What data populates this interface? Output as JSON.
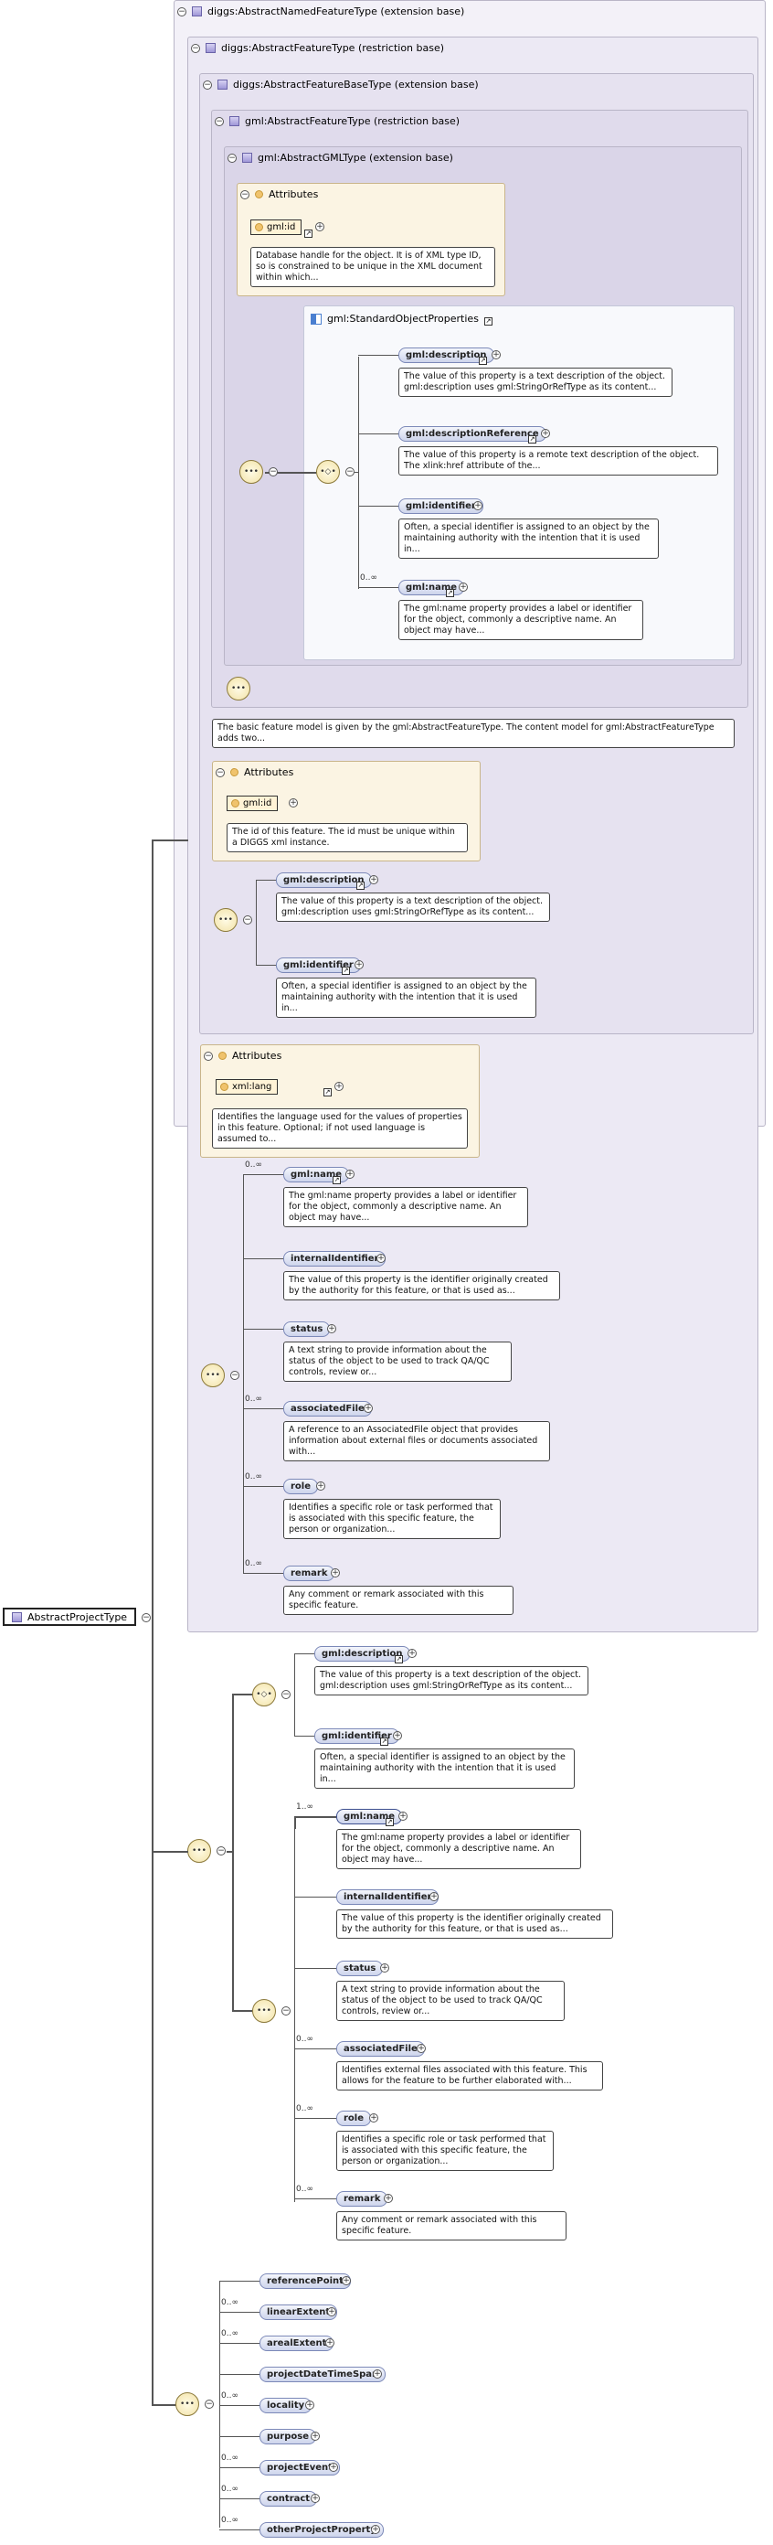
{
  "root": {
    "label": "AbstractProjectType"
  },
  "diagram": {
    "named_feature": "diggs:AbstractNamedFeatureType (extension base)",
    "diggs_feature": "diggs:AbstractFeatureType (restriction base)",
    "diggs_feature_base": "diggs:AbstractFeatureBaseType (extension base)",
    "gml_feature": "gml:AbstractFeatureType (restriction base)",
    "gml_gml": "gml:AbstractGMLType (extension base)",
    "attributes": "Attributes",
    "gml_id": "gml:id",
    "gml_id_doc": "Database handle for the object. It is of XML type ID, so is constrained to be unique in the XML document within which...",
    "std_props": "gml:StandardObjectProperties",
    "std": [
      {
        "label": "gml:description",
        "doc": "The value of this property is a text description of the object. gml:description uses gml:StringOrRefType as its content..."
      },
      {
        "label": "gml:descriptionReference",
        "doc": "The value of this property is a remote text description of the object. The xlink:href attribute of the..."
      },
      {
        "label": "gml:identifier",
        "doc": "Often, a special identifier is assigned to an object by the maintaining authority with the intention that it is used in..."
      },
      {
        "label": "gml:name",
        "card": "0..∞",
        "doc": "The gml:name property provides a label or identifier for the object, commonly a descriptive name. An object may have..."
      }
    ],
    "feature_doc": "The basic feature model is given by the gml:AbstractFeatureType. The content model for gml:AbstractFeatureType adds two...",
    "gml_id2_doc": "The id of this feature. The id must be unique within a DIGGS xml instance.",
    "base_elems": [
      {
        "label": "gml:description",
        "doc": "The value of this property is a text description of the object. gml:description uses gml:StringOrRefType as its content..."
      },
      {
        "label": "gml:identifier",
        "doc": "Often, a special identifier is assigned to an object by the maintaining authority with the intention that it is used in..."
      }
    ],
    "xml_lang": "xml:lang",
    "xml_lang_doc": "Identifies the language used for the values of properties in this feature. Optional; if not used language is assumed to...",
    "named_elems": [
      {
        "label": "gml:name",
        "card": "0..∞",
        "doc": "The gml:name property provides a label or identifier for the object, commonly a descriptive name. An object may have..."
      },
      {
        "label": "internalIdentifier",
        "card": "",
        "doc": "The value of this property is the identifier originally created by the authority for this feature, or that is used as..."
      },
      {
        "label": "status",
        "card": "",
        "doc": "A text string to provide information about the status of the object to be used to track QA/QC controls, review or..."
      },
      {
        "label": "associatedFile",
        "card": "0..∞",
        "doc": "A reference to an AssociatedFile object that provides information about external files or documents associated with..."
      },
      {
        "label": "role",
        "card": "0..∞",
        "doc": "Identifies a specific role or task performed that is associated with this specific feature, the person or organization..."
      },
      {
        "label": "remark",
        "card": "0..∞",
        "doc": "Any comment or remark associated with this specific feature."
      }
    ],
    "restr_elems_a": [
      {
        "label": "gml:description",
        "doc": "The value of this property is a text description of the object. gml:description uses gml:StringOrRefType as its content..."
      },
      {
        "label": "gml:identifier",
        "doc": "Often, a special identifier is assigned to an object by the maintaining authority with the intention that it is used in..."
      }
    ],
    "restr_elems_b": [
      {
        "label": "gml:name",
        "card": "1..∞",
        "doc": "The gml:name property provides a label or identifier for the object, commonly a descriptive name. An object may have..."
      },
      {
        "label": "internalIdentifier",
        "card": "",
        "doc": "The value of this property is the identifier originally created by the authority for this feature, or that is used as..."
      },
      {
        "label": "status",
        "card": "",
        "doc": "A text string to provide information about the status of the object to be used to track QA/QC controls, review or..."
      },
      {
        "label": "associatedFile",
        "card": "0..∞",
        "doc": "Identifies external files associated with this feature. This allows for the feature to be further elaborated with..."
      },
      {
        "label": "role",
        "card": "0..∞",
        "doc": "Identifies a specific role or task performed that is associated with this specific feature, the person or organization..."
      },
      {
        "label": "remark",
        "card": "0..∞",
        "doc": "Any comment or remark associated with this specific feature."
      }
    ],
    "project_elems": [
      {
        "label": "referencePoint",
        "card": ""
      },
      {
        "label": "linearExtent",
        "card": "0..∞"
      },
      {
        "label": "arealExtent",
        "card": "0..∞"
      },
      {
        "label": "projectDateTimeSpan",
        "card": ""
      },
      {
        "label": "locality",
        "card": "0..∞"
      },
      {
        "label": "purpose",
        "card": ""
      },
      {
        "label": "projectEvent",
        "card": "0..∞"
      },
      {
        "label": "contract",
        "card": "0..∞"
      },
      {
        "label": "otherProjectProperty",
        "card": "0..∞"
      }
    ]
  }
}
